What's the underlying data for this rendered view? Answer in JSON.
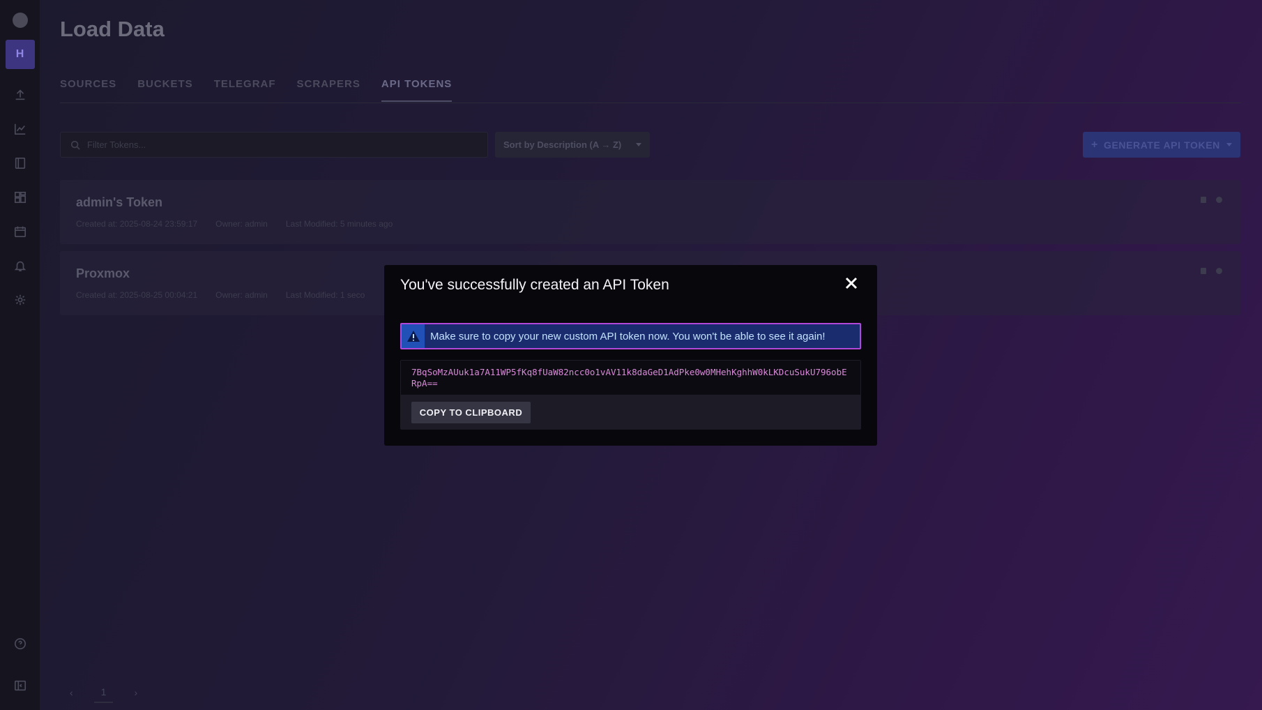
{
  "sidebar": {
    "org_initial": "H",
    "items": [
      {
        "icon": "upload-icon"
      },
      {
        "icon": "graph-icon"
      },
      {
        "icon": "notebook-icon"
      },
      {
        "icon": "dashboards-icon"
      },
      {
        "icon": "calendar-icon"
      },
      {
        "icon": "bell-icon"
      },
      {
        "icon": "gear-icon"
      }
    ],
    "bottom": [
      {
        "icon": "help-icon"
      },
      {
        "icon": "collapse-icon"
      }
    ]
  },
  "page": {
    "title": "Load Data",
    "tabs": [
      {
        "label": "SOURCES",
        "active": false
      },
      {
        "label": "BUCKETS",
        "active": false
      },
      {
        "label": "TELEGRAF",
        "active": false
      },
      {
        "label": "SCRAPERS",
        "active": false
      },
      {
        "label": "API TOKENS",
        "active": true
      }
    ]
  },
  "toolbar": {
    "filter_placeholder": "Filter Tokens...",
    "sort_label": "Sort by Description (A → Z)",
    "generate_label": "GENERATE API TOKEN",
    "generate_plus": "+"
  },
  "tokens": [
    {
      "name": "admin's Token",
      "created": "Created at: 2025-08-24 23:59:17",
      "owner": "Owner: admin",
      "modified": "Last Modified: 5 minutes ago"
    },
    {
      "name": "Proxmox",
      "created": "Created at: 2025-08-25 00:04:21",
      "owner": "Owner: admin",
      "modified": "Last Modified: 1 seco"
    }
  ],
  "pagination": {
    "prev": "‹",
    "current": "1",
    "next": "›"
  },
  "modal": {
    "title": "You've successfully created an API Token",
    "alert": "Make sure to copy your new custom API token now. You won't be able to see it again!",
    "token": "7BqSoMzAUuk1a7A11WP5fKq8fUaW82ncc0o1vAV11k8daGeD1AdPke0w0MHehKghhW0kLKDcuSukU796obERpA==",
    "copy_label": "COPY TO CLIPBOARD",
    "colors": {
      "alert_bg": "#1a2c6e",
      "alert_border": "#b347d8",
      "token_text": "#d98ad8"
    }
  }
}
